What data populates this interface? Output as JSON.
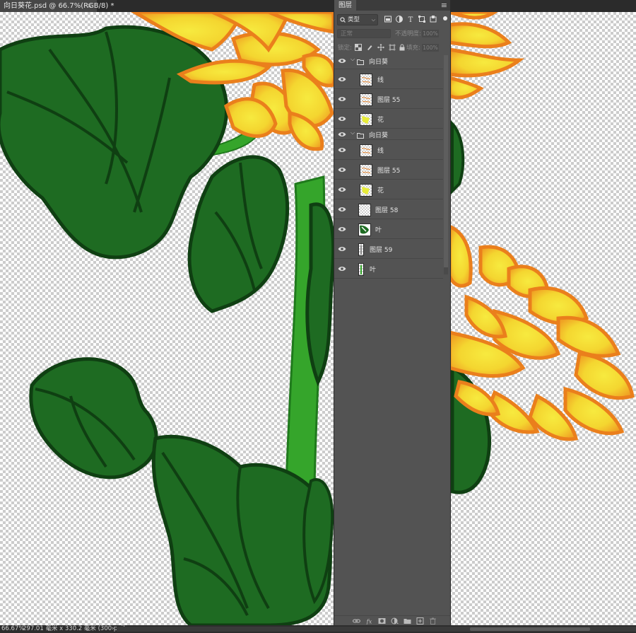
{
  "document_tab": {
    "title": "向日葵花.psd @ 66.7%(RGB/8) *",
    "close": "×"
  },
  "status_bar": {
    "zoom": "66.67%",
    "doc_info": "297.01 毫米 x 330.2 毫米 (300 ppi)",
    "arrow": "›"
  },
  "layers_panel": {
    "title": "图层",
    "menu_icon": "menu-icon",
    "filter": {
      "kind_label": "类型",
      "icons": [
        "image-filter-icon",
        "adjustment-filter-icon",
        "type-filter-icon",
        "shape-filter-icon",
        "smart-object-filter-icon"
      ]
    },
    "blend_mode": "正常",
    "opacity_label": "不透明度:",
    "opacity_value": "100%",
    "lock_label": "锁定:",
    "lock_icons": [
      "lock-transparent-icon",
      "lock-paint-icon",
      "lock-position-icon",
      "lock-artboard-icon",
      "lock-all-icon"
    ],
    "fill_label": "填充:",
    "fill_value": "100%",
    "layers": [
      {
        "kind": "group",
        "name": "向日葵",
        "visible": true
      },
      {
        "kind": "layer",
        "name": "线",
        "visible": true,
        "thumb": "line-art"
      },
      {
        "kind": "layer",
        "name": "图层 55",
        "visible": true,
        "thumb": "line-art"
      },
      {
        "kind": "layer",
        "name": "花",
        "visible": true,
        "thumb": "yellow-flower"
      },
      {
        "kind": "group",
        "name": "向日葵",
        "visible": true
      },
      {
        "kind": "layer",
        "name": "线",
        "visible": true,
        "thumb": "line-art"
      },
      {
        "kind": "layer",
        "name": "图层 55",
        "visible": true,
        "thumb": "line-art"
      },
      {
        "kind": "layer",
        "name": "花",
        "visible": true,
        "thumb": "yellow-flower"
      },
      {
        "kind": "layer",
        "name": "图层 58",
        "visible": true,
        "thumb": "transparent"
      },
      {
        "kind": "layer",
        "name": "叶",
        "visible": true,
        "thumb": "green-leaves"
      },
      {
        "kind": "layer",
        "name": "图层 59",
        "visible": true,
        "thumb": "narrow"
      },
      {
        "kind": "layer",
        "name": "叶",
        "visible": true,
        "thumb": "narrow-green"
      }
    ],
    "bottom_icons": [
      "link-layers-icon",
      "fx-icon",
      "add-mask-icon",
      "adjustment-layer-icon",
      "new-group-icon",
      "new-layer-icon",
      "delete-layer-icon"
    ]
  },
  "colors": {
    "ui_dark": "#535353",
    "leaf_fill": "#1e6b22",
    "leaf_outline": "#0f3f12",
    "stem": "#35a52b",
    "petal_orange": "#f08a1f",
    "petal_yellow": "#f3e23a"
  }
}
